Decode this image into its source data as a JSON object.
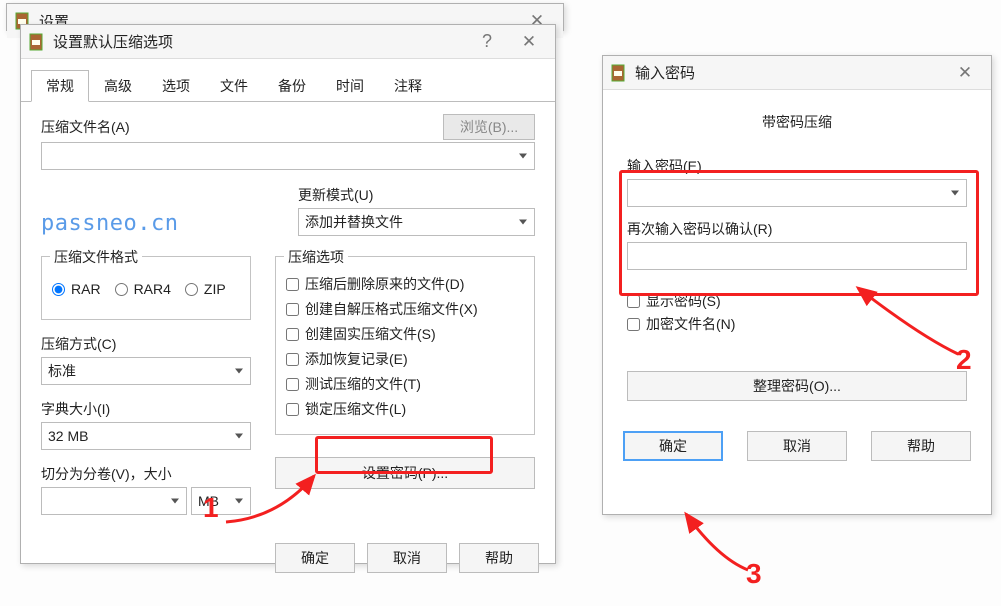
{
  "bg_window": {
    "title": "设置"
  },
  "dlg1": {
    "title": "设置默认压缩选项",
    "tabs": [
      "常规",
      "高级",
      "选项",
      "文件",
      "备份",
      "时间",
      "注释"
    ],
    "active_tab": 0,
    "archive_name_label": "压缩文件名(A)",
    "archive_name_value": "",
    "browse_btn": "浏览(B)...",
    "watermark": "passneo.cn",
    "update_mode_label": "更新模式(U)",
    "update_mode_value": "添加并替换文件",
    "format_group": "压缩文件格式",
    "format_opts": [
      "RAR",
      "RAR4",
      "ZIP"
    ],
    "format_selected": 0,
    "options_group": "压缩选项",
    "options": [
      "压缩后删除原来的文件(D)",
      "创建自解压格式压缩文件(X)",
      "创建固实压缩文件(S)",
      "添加恢复记录(E)",
      "测试压缩的文件(T)",
      "锁定压缩文件(L)"
    ],
    "method_label": "压缩方式(C)",
    "method_value": "标准",
    "dict_label": "字典大小(I)",
    "dict_value": "32 MB",
    "split_label": "切分为分卷(V)，大小",
    "split_value": "",
    "split_unit": "MB",
    "set_password_btn": "设置密码(P)...",
    "ok": "确定",
    "cancel": "取消",
    "help": "帮助"
  },
  "dlg2": {
    "title": "输入密码",
    "subtitle": "带密码压缩",
    "enter_pw_label": "输入密码(E)",
    "enter_pw_value": "",
    "reenter_pw_label": "再次输入密码以确认(R)",
    "reenter_pw_value": "",
    "show_pw": "显示密码(S)",
    "encrypt_names": "加密文件名(N)",
    "organize_btn": "整理密码(O)...",
    "ok": "确定",
    "cancel": "取消",
    "help": "帮助"
  },
  "annotations": {
    "n1": "1",
    "n2": "2",
    "n3": "3"
  }
}
